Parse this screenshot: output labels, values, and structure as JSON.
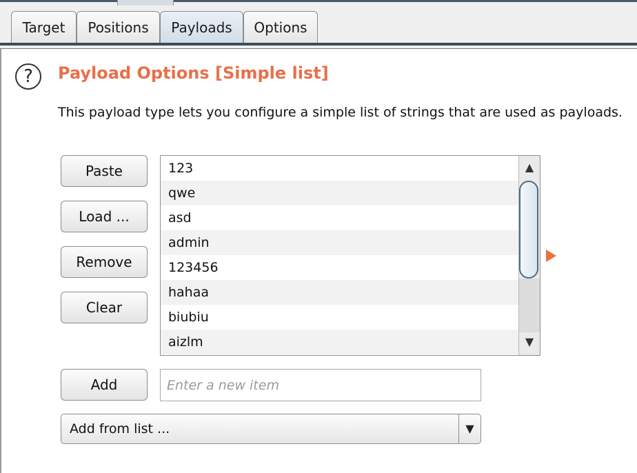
{
  "tabs": [
    {
      "label": "Target",
      "active": false
    },
    {
      "label": "Positions",
      "active": false
    },
    {
      "label": "Payloads",
      "active": true
    },
    {
      "label": "Options",
      "active": false
    }
  ],
  "panel": {
    "help_icon_glyph": "?",
    "title": "Payload Options [Simple list]",
    "description": "This payload type lets you configure a simple list of strings that are used as payloads."
  },
  "buttons": {
    "paste": "Paste",
    "load": "Load ...",
    "remove": "Remove",
    "clear": "Clear",
    "add": "Add"
  },
  "payload_list": {
    "items": [
      "123",
      "qwe",
      "asd",
      "admin",
      "123456",
      "hahaa",
      "biubiu",
      "aizlm"
    ],
    "scroll_up_glyph": "▲",
    "scroll_down_glyph": "▼"
  },
  "add_item": {
    "value": "",
    "placeholder": "Enter a new item"
  },
  "add_from_list": {
    "selected": "Add from list ...",
    "arrow_glyph": "▼"
  },
  "colors": {
    "title": "#e8704a",
    "accent_arrow": "#e8733a",
    "row_alt": "#f2f2f2"
  }
}
